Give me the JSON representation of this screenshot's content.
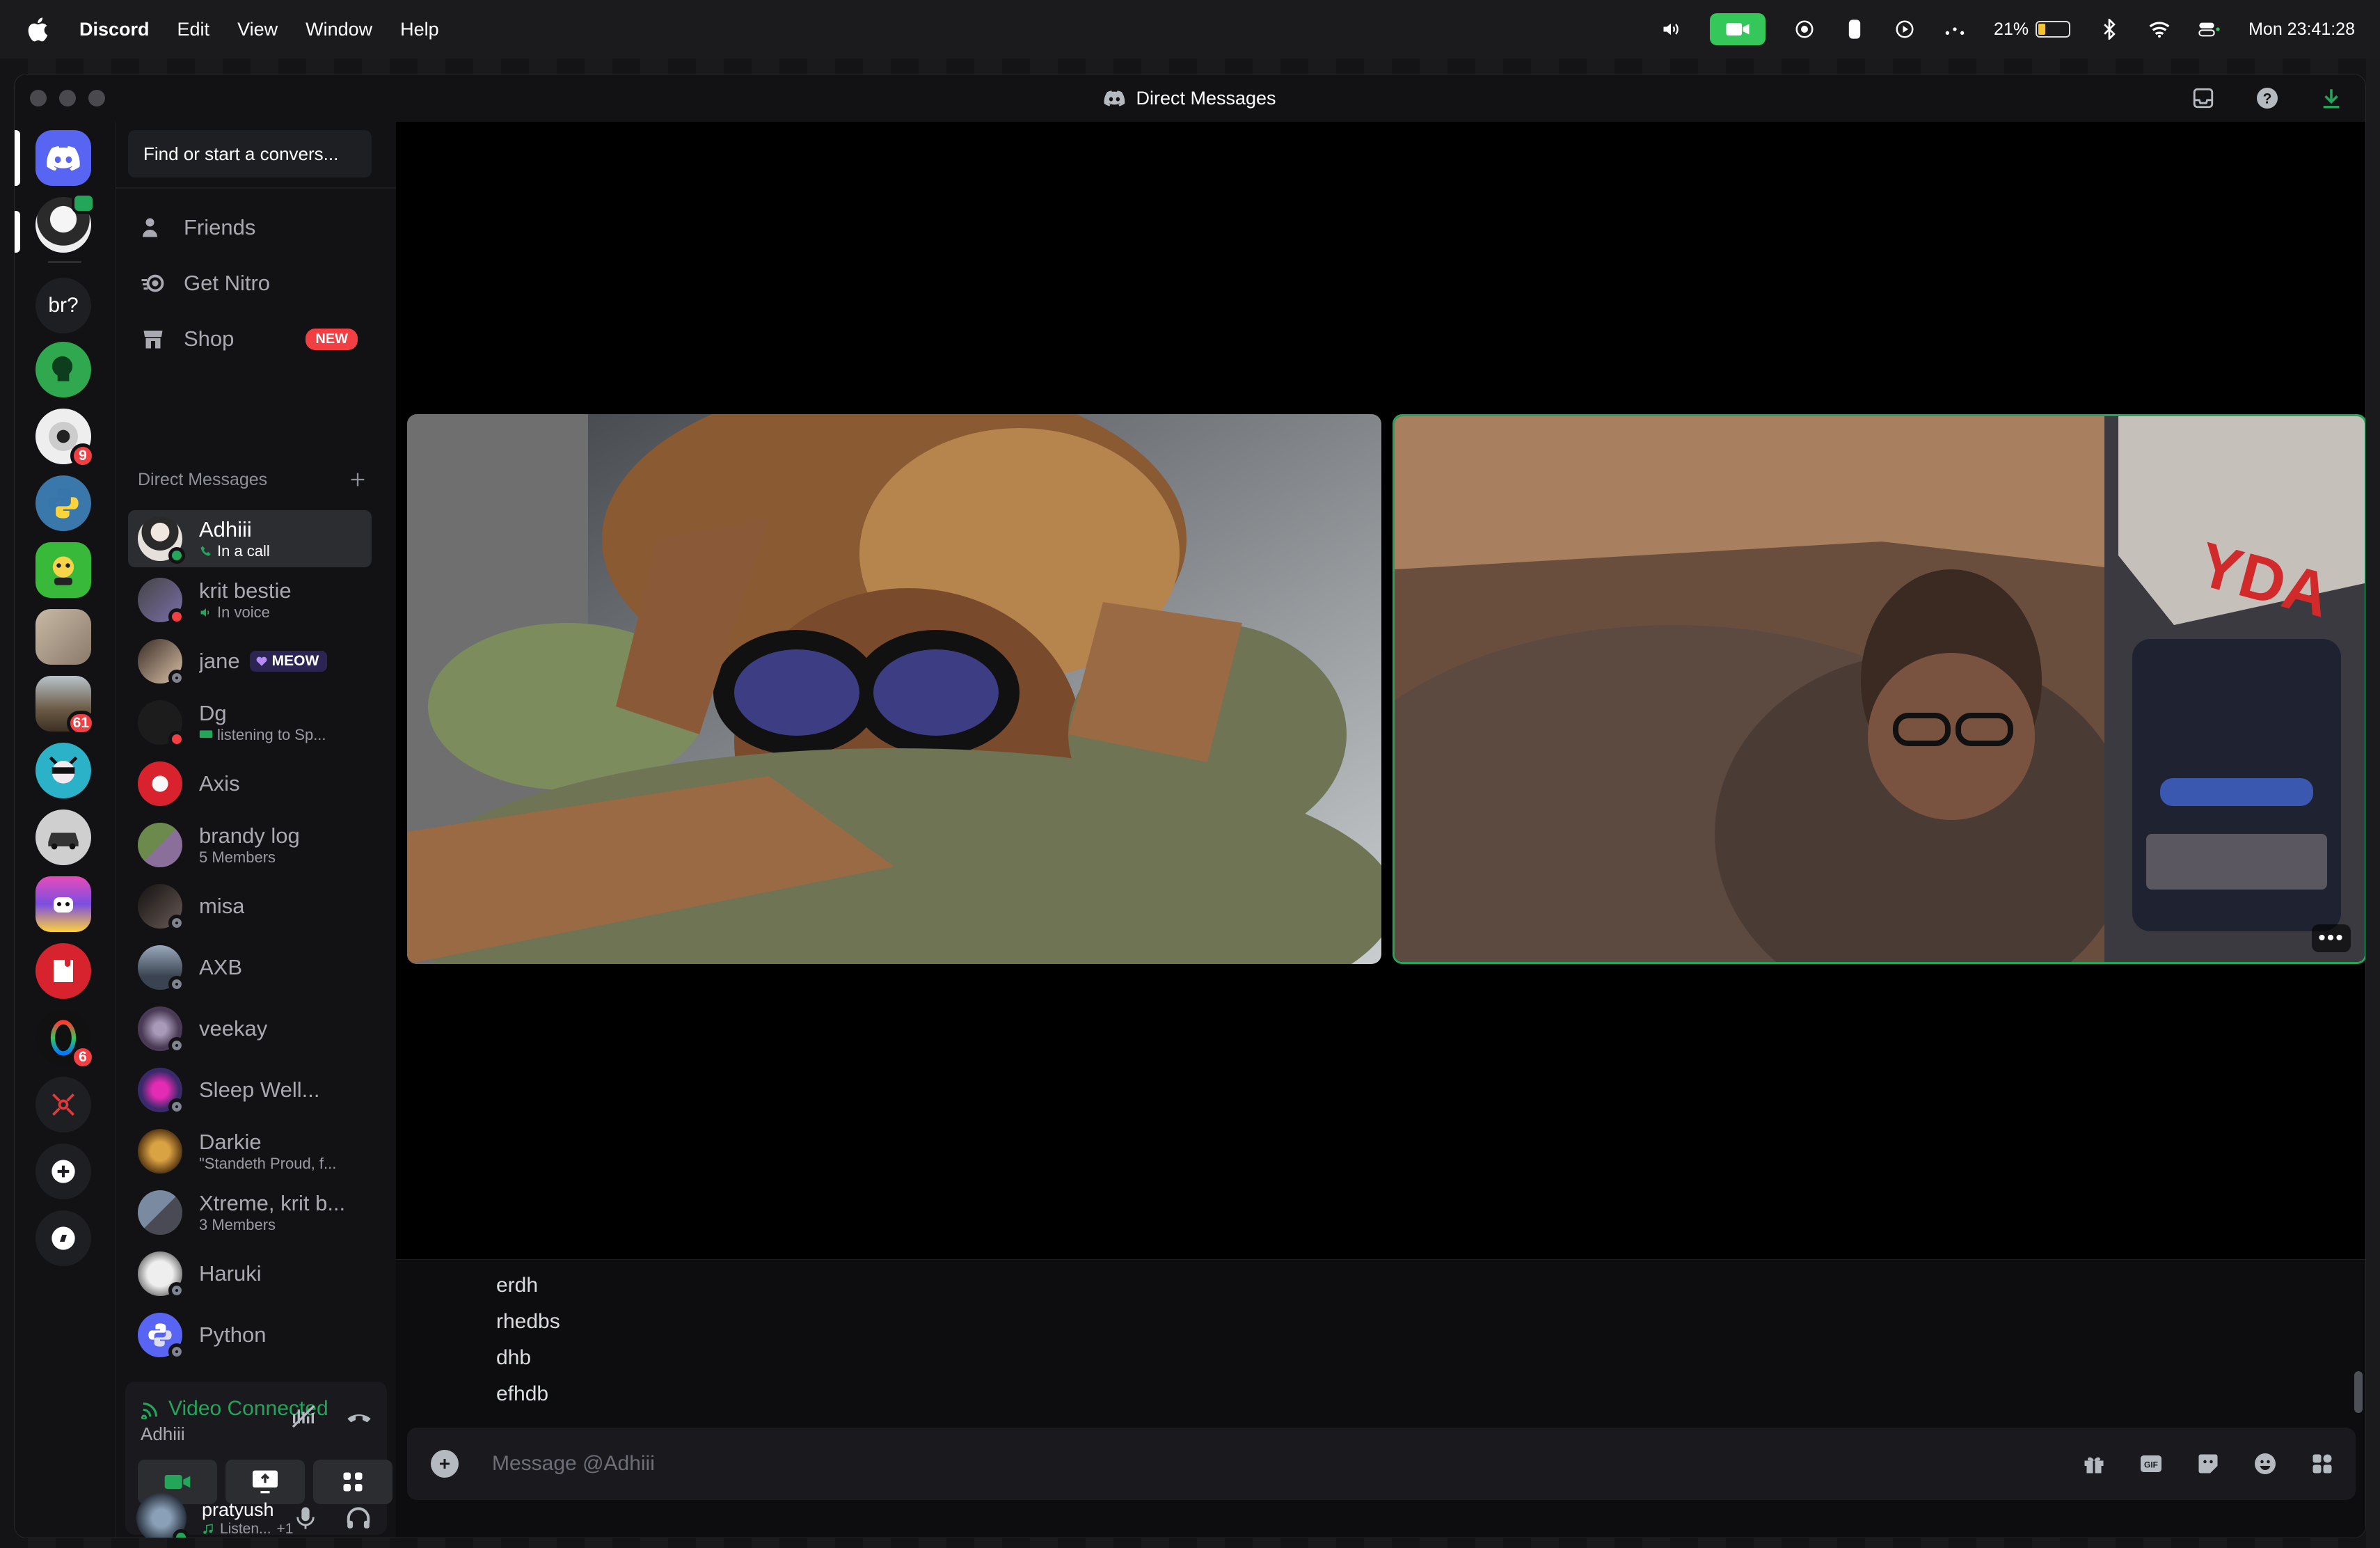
{
  "menubar": {
    "app": "Discord",
    "items": [
      "Edit",
      "View",
      "Window",
      "Help"
    ],
    "battery": "21%",
    "clock": "Mon 23:41:28"
  },
  "window": {
    "title": "Direct Messages"
  },
  "servers": [
    {
      "name": "home",
      "badge": ""
    },
    {
      "name": "avatar-server",
      "badge": ""
    },
    {
      "name": "br?",
      "label": "br?",
      "badge": ""
    },
    {
      "name": "green-server",
      "badge": ""
    },
    {
      "name": "white-flower-server",
      "badge": "9"
    },
    {
      "name": "python-server",
      "badge": ""
    },
    {
      "name": "game-server",
      "badge": ""
    },
    {
      "name": "cat-photo-server",
      "badge": ""
    },
    {
      "name": "landscape-server",
      "badge": "61"
    },
    {
      "name": "anime-server",
      "badge": ""
    },
    {
      "name": "car-server",
      "badge": ""
    },
    {
      "name": "colorful-server",
      "badge": ""
    },
    {
      "name": "red-server",
      "badge": ""
    },
    {
      "name": "rainbow-ring-server",
      "badge": "6"
    },
    {
      "name": "network-server",
      "badge": ""
    }
  ],
  "sidebar": {
    "search_placeholder": "Find or start a convers...",
    "nav": [
      {
        "label": "Friends"
      },
      {
        "label": "Get Nitro"
      },
      {
        "label": "Shop",
        "tag": "NEW"
      }
    ],
    "dm_header": "Direct Messages",
    "dms": [
      {
        "name": "Adhiii",
        "sub": "In a call",
        "status": "online",
        "active": true
      },
      {
        "name": "krit bestie",
        "sub": "In voice",
        "status": "dnd"
      },
      {
        "name": "jane",
        "sub": "",
        "tag": "MEOW",
        "status": "offline"
      },
      {
        "name": "Dg",
        "sub": "listening to Sp...",
        "status": "dnd"
      },
      {
        "name": "Axis",
        "sub": "",
        "status": "none"
      },
      {
        "name": "brandy log",
        "sub": "5 Members",
        "status": "none"
      },
      {
        "name": "misa",
        "sub": "",
        "status": "offline"
      },
      {
        "name": "AXB",
        "sub": "",
        "status": "offline"
      },
      {
        "name": "veekay",
        "sub": "",
        "status": "offline"
      },
      {
        "name": "Sleep Well...",
        "sub": "",
        "status": "offline"
      },
      {
        "name": "Darkie",
        "sub": "\"Standeth Proud, f...",
        "status": "none"
      },
      {
        "name": "Xtreme, krit b...",
        "sub": "3 Members",
        "status": "none"
      },
      {
        "name": "Haruki",
        "sub": "",
        "status": "offline"
      },
      {
        "name": "Python",
        "sub": "",
        "status": "offline"
      }
    ]
  },
  "voice": {
    "status": "Video Connected",
    "channel": "Adhiii"
  },
  "user": {
    "name": "pratyush",
    "activity": "Listen...",
    "extra": "+1"
  },
  "messages": [
    "erdh",
    "rhedbs",
    "dhb",
    "efhdb"
  ],
  "composer": {
    "placeholder": "Message @Adhiii"
  },
  "colors": {
    "accent": "#5865f2",
    "online": "#23a55a",
    "danger": "#f23f43"
  }
}
